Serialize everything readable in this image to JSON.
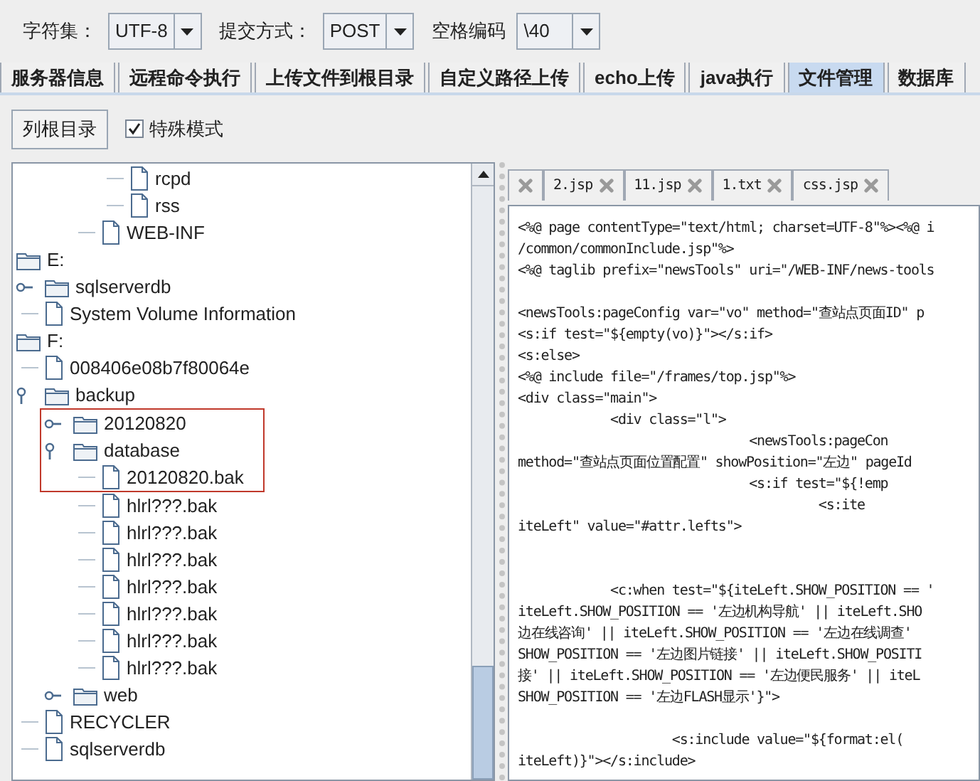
{
  "options_bar": {
    "fields": [
      {
        "label": "字符集：",
        "value": "UTF-8"
      },
      {
        "label": "提交方式：",
        "value": "POST"
      },
      {
        "label": "空格编码",
        "value": "\\40"
      }
    ]
  },
  "tabs": [
    {
      "label": "服务器信息",
      "selected": false
    },
    {
      "label": "远程命令执行",
      "selected": false
    },
    {
      "label": "上传文件到根目录",
      "selected": false
    },
    {
      "label": "自定义路径上传",
      "selected": false
    },
    {
      "label": "echo上传",
      "selected": false
    },
    {
      "label": "java执行",
      "selected": false
    },
    {
      "label": "文件管理",
      "selected": true
    },
    {
      "label": "数据库",
      "selected": false
    }
  ],
  "toolbar": {
    "button": "列根目录",
    "checkbox": {
      "label": "特殊模式",
      "checked": true
    }
  },
  "tree": [
    {
      "children": [
        {
          "children": [
            {
              "children": [
                {
                  "children": [
                    {
                      "kind": "file",
                      "label": "rcpd",
                      "boxed": false
                    },
                    {
                      "kind": "file",
                      "label": "rss",
                      "boxed": false
                    }
                  ]
                },
                {
                  "kind": "file",
                  "label": "WEB-INF",
                  "boxed": false
                }
              ]
            }
          ]
        }
      ]
    },
    {
      "kind": "folder",
      "label": "E:",
      "boxed": false,
      "children": [
        {
          "kind": "folder",
          "label": "sqlserverdb",
          "expanded": false,
          "boxed": false
        },
        {
          "kind": "file",
          "label": "System Volume Information",
          "boxed": false
        }
      ]
    },
    {
      "kind": "folder",
      "label": "F:",
      "boxed": false,
      "children": [
        {
          "kind": "file",
          "label": "008406e08b7f80064e",
          "boxed": false
        },
        {
          "kind": "folder",
          "label": "backup",
          "expanded": true,
          "boxed": false,
          "children": [
            {
              "kind": "folder",
              "label": "20120820",
              "expanded": false,
              "boxed": true
            },
            {
              "kind": "folder",
              "label": "database",
              "expanded": true,
              "boxed": true,
              "children": [
                {
                  "kind": "file",
                  "label": "20120820.bak",
                  "boxed": true
                },
                {
                  "kind": "file",
                  "label": "hlrl???.bak",
                  "boxed": false
                },
                {
                  "kind": "file",
                  "label": "hlrl???.bak",
                  "boxed": false
                },
                {
                  "kind": "file",
                  "label": "hlrl???.bak",
                  "boxed": false
                },
                {
                  "kind": "file",
                  "label": "hlrl???.bak",
                  "boxed": false
                },
                {
                  "kind": "file",
                  "label": "hlrl???.bak",
                  "boxed": false
                },
                {
                  "kind": "file",
                  "label": "hlrl???.bak",
                  "boxed": false
                },
                {
                  "kind": "file",
                  "label": "hlrl???.bak",
                  "boxed": false
                }
              ]
            },
            {
              "kind": "folder",
              "label": "web",
              "expanded": false,
              "boxed": false
            }
          ]
        },
        {
          "kind": "file",
          "label": "RECYCLER",
          "boxed": false
        },
        {
          "kind": "file",
          "label": "sqlserverdb",
          "boxed": false
        }
      ]
    }
  ],
  "editor_tabs": [
    {
      "closable": true
    },
    {
      "label": "2.jsp",
      "closable": true
    },
    {
      "label": "11.jsp",
      "closable": true
    },
    {
      "label": "1.txt",
      "closable": true
    },
    {
      "label": "css.jsp",
      "closable": true
    }
  ],
  "code": [
    {
      "kind": "code",
      "text": "<%@ page contentType=\"text/html; charset=UTF-8\"%><%@ i"
    },
    {
      "kind": "code",
      "text": "/common/commonInclude.jsp\"%>"
    },
    {
      "kind": "code",
      "text": "<%@ taglib prefix=\"newsTools\" uri=\"/WEB-INF/news-tools"
    },
    {
      "kind": "blank"
    },
    {
      "kind": "code",
      "text": "<newsTools:pageConfig var=\"vo\" method=\"查站点页面ID\" p"
    },
    {
      "kind": "code",
      "text": "<s:if test=\"${empty(vo)}\"></s:if>"
    },
    {
      "kind": "code",
      "text": "<s:else>"
    },
    {
      "kind": "code",
      "text": "<%@ include file=\"/frames/top.jsp\"%>"
    },
    {
      "kind": "code",
      "text": "<div class=\"main\">"
    },
    {
      "kind": "code",
      "text": "            <div class=\"l\">"
    },
    {
      "kind": "code",
      "text": "                              <newsTools:pageCon"
    },
    {
      "kind": "code",
      "text": "method=\"查站点页面位置配置\" showPosition=\"左边\" pageId"
    },
    {
      "kind": "code",
      "text": "                              <s:if test=\"${!emp"
    },
    {
      "kind": "code",
      "text": "                                       <s:ite"
    },
    {
      "kind": "code",
      "text": "iteLeft\" value=\"#attr.lefts\">"
    },
    {
      "kind": "blank"
    },
    {
      "kind": "blank"
    },
    {
      "kind": "code",
      "text": "            <c:when test=\"${iteLeft.SHOW_POSITION == '"
    },
    {
      "kind": "code",
      "text": "iteLeft.SHOW_POSITION == '左边机构导航' || iteLeft.SHO"
    },
    {
      "kind": "code",
      "text": "边在线咨询' || iteLeft.SHOW_POSITION == '左边在线调查'"
    },
    {
      "kind": "code",
      "text": "SHOW_POSITION == '左边图片链接' || iteLeft.SHOW_POSITI"
    },
    {
      "kind": "code",
      "text": "接' || iteLeft.SHOW_POSITION == '左边便民服务' || iteL"
    },
    {
      "kind": "code",
      "text": "SHOW_POSITION == '左边FLASH显示'}\">"
    },
    {
      "kind": "blank"
    },
    {
      "kind": "code",
      "text": "                    <s:include value=\"${format:el("
    },
    {
      "kind": "code",
      "text": "iteLeft)}\"></s:include>"
    }
  ]
}
